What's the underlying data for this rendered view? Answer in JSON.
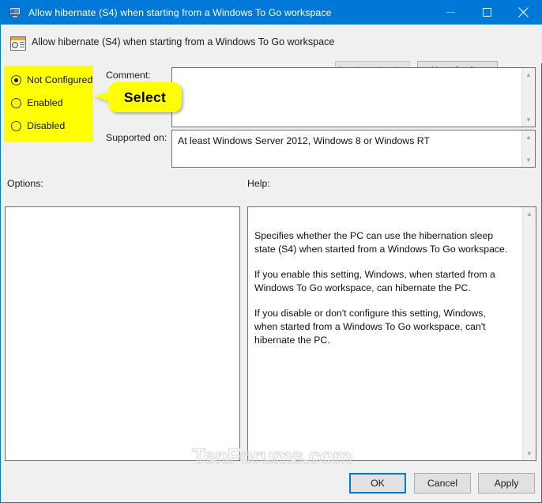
{
  "window": {
    "title": "Allow hibernate (S4) when starting from a Windows To Go workspace",
    "icon": "computer-monitor-icon",
    "minimize_label": "Minimize",
    "maximize_label": "Maximize",
    "close_label": "Close",
    "accent_color": "#0078d7",
    "chrome_color": "#f0f0f0"
  },
  "header": {
    "icon": "group-policy-setting-icon",
    "title": "Allow hibernate (S4) when starting from a Windows To Go workspace",
    "previous_setting_label": "Previous Setting",
    "next_setting_label": "Next Setting",
    "previous_setting_enabled": false,
    "next_setting_enabled": true
  },
  "state": {
    "highlight_color": "#ffff00",
    "selected": "Not Configured",
    "options": [
      {
        "label": "Not Configured",
        "checked": true
      },
      {
        "label": "Enabled",
        "checked": false
      },
      {
        "label": "Disabled",
        "checked": false
      }
    ]
  },
  "callout": {
    "text": "Select",
    "background": "#ffff00",
    "text_color": "#000000"
  },
  "comment": {
    "label": "Comment:",
    "value": "",
    "scroll_up_icon": "chevron-up-icon",
    "scroll_down_icon": "chevron-down-icon"
  },
  "supported_on": {
    "label": "Supported on:",
    "value": "At least Windows Server 2012, Windows 8 or Windows RT",
    "scroll_up_icon": "chevron-up-icon",
    "scroll_down_icon": "chevron-down-icon"
  },
  "options_panel": {
    "label": "Options:",
    "content": ""
  },
  "help_panel": {
    "label": "Help:",
    "paragraphs": [
      "Specifies whether the PC can use the hibernation sleep state (S4) when started from a Windows To Go workspace.",
      "If you enable this setting, Windows, when started from a Windows To Go workspace, can hibernate the PC.",
      "If you disable or don't configure this setting, Windows, when started from a Windows To Go workspace, can't hibernate the PC."
    ],
    "scroll_up_icon": "chevron-up-icon",
    "scroll_down_icon": "chevron-down-icon"
  },
  "watermark": {
    "text": "TenForums.com"
  },
  "footer": {
    "ok_label": "OK",
    "cancel_label": "Cancel",
    "apply_label": "Apply",
    "default_button": "OK"
  }
}
